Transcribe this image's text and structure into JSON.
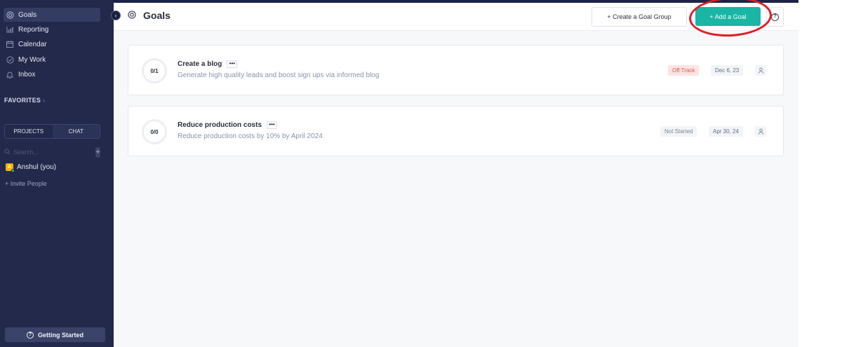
{
  "sidebar": {
    "nav": [
      {
        "label": "Goals",
        "icon": "goals-icon",
        "active": true
      },
      {
        "label": "Reporting",
        "icon": "reporting-icon"
      },
      {
        "label": "Calendar",
        "icon": "calendar-icon"
      },
      {
        "label": "My Work",
        "icon": "my-work-icon"
      },
      {
        "label": "Inbox",
        "icon": "inbox-icon"
      }
    ],
    "favorites_label": "FAVORITES",
    "tabs": [
      {
        "label": "PROJECTS"
      },
      {
        "label": "CHAT",
        "active": true
      }
    ],
    "search_placeholder": "Search...",
    "user": {
      "initial": "A",
      "name": "Anshul (you)"
    },
    "invite_label": "+ Invite People",
    "getting_started_label": "Getting Started"
  },
  "header": {
    "title": "Goals",
    "create_group_label": "+ Create a Goal Group",
    "add_goal_label": "+ Add a Goal",
    "highlight_color": "#e21c25",
    "accent_color": "#19b5a5"
  },
  "goals": [
    {
      "progress": "0/1",
      "title": "Create a blog",
      "more": "•••",
      "description": "Generate high quality leads and boost sign ups via informed blog",
      "status": "Off Track",
      "status_color": "#e5534b",
      "date": "Dec 6, 23"
    },
    {
      "progress": "0/0",
      "title": "Reduce production costs",
      "more": "•••",
      "description": "Reduce production costs by 10% by April 2024",
      "status": "Not Started",
      "status_color": "#7c8499",
      "date": "Apr 30, 24"
    }
  ]
}
